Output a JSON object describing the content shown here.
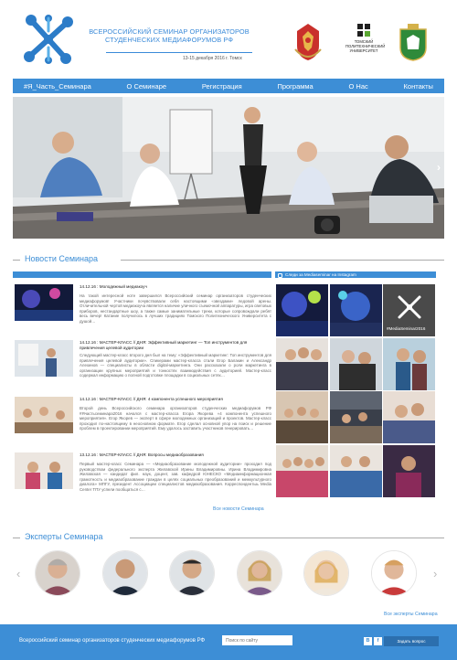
{
  "header": {
    "title": "Всероссийский семинар организаторов студенческих медиафорумов РФ",
    "dates": "13-15 декабря 2016 г. Томск",
    "tpu": "ТОМСКИЙ ПОЛИТЕХНИЧЕСКИЙ УНИВЕРСИТЕТ"
  },
  "nav": [
    "#Я_Часть_Семинара",
    "О Семинаре",
    "Регистрация",
    "Программа",
    "О Нас",
    "Контакты"
  ],
  "sections": {
    "news": "Новости Семинара",
    "experts": "Эксперты Семинара"
  },
  "news": [
    {
      "date_title": "14.12.16 : Молодежный медиакоуч",
      "text": "На такой интересной ноте завершился Всероссийский семинар организаторов студенческих медиафорумов! Участники почувствовали себя настоящими «звездами» ледовой арены. Отличительной чертой медиакоуча является наличие уличного съемочной аппаратуры, игра световых приборов, нестандартные шоу, а также самые занимательные треки, которые сопровождали ребят весь вечер! Катание получилось в лучших традициях Томского Политехнического Университета с душой…"
    },
    {
      "date_title": "14.12.16 : МАСТЕР-КЛАСС // ДНЯ: Эффективный маркетинг — Топ инструментов для привлечения целевой аудитории",
      "text": "Следующий мастер-класс второго дня был на тему: «Эффективный маркетинг: Топ инструментов для привлечения целевой аудитории». Спикерами мастер-класса стали Егор Балакин и Александр Алехинов — специалисты в области digital-маркетинга. Они рассказали о роли маркетинга в организации крупных мероприятий и тонкостях взаимодействия с аудиторией. Мастер-класс содержал информацию о полной подготовке площадки в социальных сетях…"
    },
    {
      "date_title": "14.12.16 : МАСТЕР-КЛАСС // ДНЯ: 4 компонента успешного мероприятия",
      "text": "Второй день Всероссийского семинара организаторов студенческих медиафорумов РФ #Ячастьсеминара2016 начался с мастер-класса Егора Якорева «4 компонента успешного мероприятия». Егор Якорев — эксперт в сфере молодежных организаций и проектов. Мастер-класс проходил по-настоящему в неосновном формате. Егор сделал основной упор на поиск и решение проблем в проектировании мероприятий. Ему удалось заставить участников генерировать…"
    },
    {
      "date_title": "13.12.16 : МАСТЕР-КЛАСС // ДНЯ: Вопросы медиаобразования",
      "text": "Первый мастер-класс Семинара — «Медиаобразование молодежной аудитории» проходил под руководством федерального эксперта Жилавской Ирины Владимировны. Ирина Владимировна Жилавская — кандидат фил. наук, доцент, зав. кафедрой ЮНЕСКО «Медиаинформационная грамотность и медиаобразование граждан в целях социальных преобразований и межкультурного диалога» МПГУ, президент Ассоциации специалистов медиаобразования. Корреспондентыь Media Center ТПУ успели пообщаться с…"
    }
  ],
  "news_all": "Все новости Семинара",
  "instagram": {
    "title": "Следи за Mediaseminar на Instagram",
    "tag": "#MediaSeminar2016"
  },
  "experts_all": "Все эксперты Семинара",
  "footer": {
    "text": "Всероссийский семинар организаторов студенческих медиафорумов РФ",
    "search_placeholder": "Поиск по сайту",
    "ask": "Задать вопрос",
    "social": [
      "B",
      "f"
    ]
  },
  "colors": {
    "brand_blue": "#3d8ed6",
    "title_blue": "#3a8ad8"
  }
}
